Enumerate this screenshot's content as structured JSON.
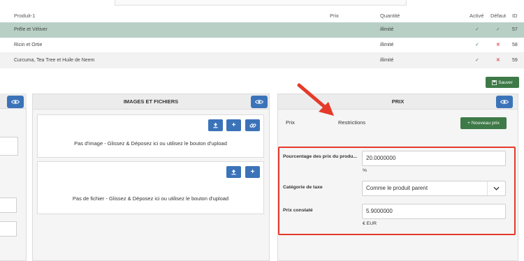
{
  "table": {
    "headers": [
      "Produit-1",
      "Prix",
      "Quantité",
      "Activé",
      "Défaut",
      "ID"
    ],
    "rows": [
      {
        "name": "Prêle et Vétiver",
        "price": "",
        "qty": "illimité",
        "active": "✓",
        "default": "✓",
        "id": "57"
      },
      {
        "name": "Ricin et Ortie",
        "price": "",
        "qty": "illimité",
        "active": "✓",
        "default": "✕",
        "id": "58"
      },
      {
        "name": "Curcuma, Tea Tree et Huile de Neem",
        "price": "",
        "qty": "illimité",
        "active": "✓",
        "default": "✕",
        "id": "59"
      }
    ]
  },
  "save_button": {
    "label": "Sauver"
  },
  "images_panel": {
    "title": "IMAGES ET FICHIERS",
    "no_image_text": "Pas d'image - Glissez & Déposez ici ou utilisez le bouton d'upload",
    "no_file_text": "Pas de fichier - Glissez & Déposez ici ou utilisez le bouton d'upload"
  },
  "price_panel": {
    "title": "PRIX",
    "tabs": [
      "Prix",
      "Restrictions"
    ],
    "new_price_button": "+ Nouveau prix",
    "fields": {
      "percentage_label": "Pourcentage des prix du produ...",
      "percentage_value": "20.0000000",
      "percentage_unit": "%",
      "tax_label": "Catégorie de taxe",
      "tax_value": "Comme le produit parent",
      "observed_label": "Prix constaté",
      "observed_value": "5.9000000",
      "observed_unit": "€ EUR"
    }
  },
  "colors": {
    "highlight_row": "#b8cfc6",
    "primary": "#3b73b9",
    "success": "#3e7a47",
    "annotation": "#e53a2a"
  }
}
